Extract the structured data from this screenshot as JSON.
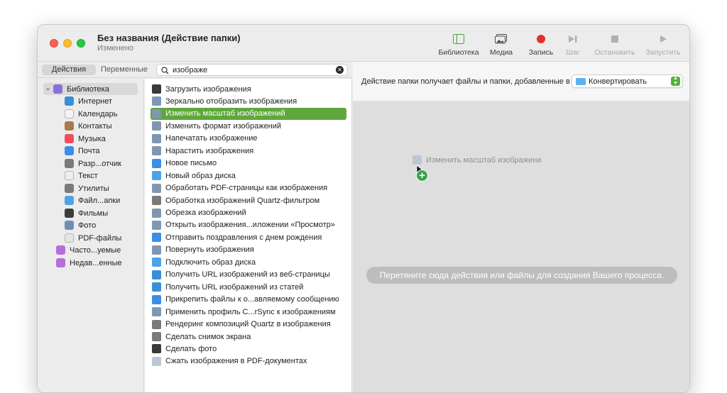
{
  "window": {
    "title": "Без названия (Действие папки)",
    "subtitle": "Изменено"
  },
  "toolbar": [
    {
      "label": "Библиотека",
      "icon": "library-icon",
      "enabled": true
    },
    {
      "label": "Медиа",
      "icon": "media-icon",
      "enabled": true
    },
    {
      "label": "Запись",
      "icon": "record-icon",
      "enabled": true
    },
    {
      "label": "Шаг",
      "icon": "step-icon",
      "enabled": false
    },
    {
      "label": "Остановить",
      "icon": "stop-icon",
      "enabled": false
    },
    {
      "label": "Запустить",
      "icon": "run-icon",
      "enabled": false
    }
  ],
  "tabs": {
    "actions": "Действия",
    "variables": "Переменные"
  },
  "search": {
    "value": "изображе"
  },
  "library": [
    {
      "label": "Библиотека",
      "icon": "library-icon",
      "selected": true,
      "color": "#8a6fd6"
    },
    {
      "label": "Интернет",
      "icon": "globe-icon",
      "color": "#3b8ed8"
    },
    {
      "label": "Календарь",
      "icon": "calendar-icon",
      "color": "#f4f4f4"
    },
    {
      "label": "Контакты",
      "icon": "contacts-icon",
      "color": "#a97a4c"
    },
    {
      "label": "Музыка",
      "icon": "music-icon",
      "color": "#f04d5b"
    },
    {
      "label": "Почта",
      "icon": "mail-icon",
      "color": "#3a8ee6"
    },
    {
      "label": "Разр...отчик",
      "icon": "developer-tools-icon",
      "color": "#7a7a7a"
    },
    {
      "label": "Текст",
      "icon": "text-icon",
      "color": "#eeeeee"
    },
    {
      "label": "Утилиты",
      "icon": "utilities-icon",
      "color": "#7a7a7a"
    },
    {
      "label": "Файл...апки",
      "icon": "finder-icon",
      "color": "#4da3e8"
    },
    {
      "label": "Фильмы",
      "icon": "movies-icon",
      "color": "#3c3c3c"
    },
    {
      "label": "Фото",
      "icon": "photo-icon",
      "color": "#6d8fb3"
    },
    {
      "label": "PDF-файлы",
      "icon": "pdf-icon",
      "color": "#e4e4e4"
    },
    {
      "label": "Часто...уемые",
      "icon": "smart-folder-icon",
      "color": "#b46fd8"
    },
    {
      "label": "Недав...енные",
      "icon": "smart-folder-icon",
      "color": "#b46fd8"
    }
  ],
  "actions": [
    {
      "label": "Загрузить изображения",
      "icon": "camera-icon",
      "color": "#3a3a3a"
    },
    {
      "label": "Зеркально отобразить изображения",
      "icon": "image-action-icon",
      "color": "#7f97b2"
    },
    {
      "label": "Изменить масштаб изображений",
      "icon": "image-action-icon",
      "color": "#7f97b2",
      "selected": true
    },
    {
      "label": "Изменить формат изображений",
      "icon": "image-action-icon",
      "color": "#7f97b2"
    },
    {
      "label": "Напечатать изображение",
      "icon": "image-action-icon",
      "color": "#7f97b2"
    },
    {
      "label": "Нарастить изображения",
      "icon": "image-action-icon",
      "color": "#7f97b2"
    },
    {
      "label": "Новое письмо",
      "icon": "mail-icon",
      "color": "#3a8ee6"
    },
    {
      "label": "Новый образ диска",
      "icon": "finder-icon",
      "color": "#4da3e8"
    },
    {
      "label": "Обработать PDF-страницы как изображения",
      "icon": "image-action-icon",
      "color": "#7f97b2"
    },
    {
      "label": "Обработка изображений Quartz-фильтром",
      "icon": "tools-icon",
      "color": "#7a7a7a"
    },
    {
      "label": "Обрезка изображений",
      "icon": "image-action-icon",
      "color": "#7f97b2"
    },
    {
      "label": "Открыть изображения...иложении «Просмотр»",
      "icon": "image-action-icon",
      "color": "#7f97b2"
    },
    {
      "label": "Отправить поздравления с днем рождения",
      "icon": "mail-icon",
      "color": "#3a8ee6"
    },
    {
      "label": "Повернуть изображения",
      "icon": "image-action-icon",
      "color": "#7f97b2"
    },
    {
      "label": "Подключить образ диска",
      "icon": "finder-icon",
      "color": "#4da3e8"
    },
    {
      "label": "Получить URL изображений из веб-страницы",
      "icon": "globe-icon",
      "color": "#3b8ed8"
    },
    {
      "label": "Получить URL изображений из статей",
      "icon": "globe-icon",
      "color": "#3b8ed8"
    },
    {
      "label": "Прикрепить файлы к о...авляемому сообщению",
      "icon": "mail-icon",
      "color": "#3a8ee6"
    },
    {
      "label": "Применить профиль C...rSync к изображениям",
      "icon": "image-action-icon",
      "color": "#7f97b2"
    },
    {
      "label": "Рендеринг композиций Quartz в изображения",
      "icon": "tools-icon",
      "color": "#7a7a7a"
    },
    {
      "label": "Сделать снимок экрана",
      "icon": "tools-icon",
      "color": "#7a7a7a"
    },
    {
      "label": "Сделать фото",
      "icon": "camera-icon",
      "color": "#3a3a3a"
    },
    {
      "label": "Сжать изображения в PDF-документах",
      "icon": "pdf-icon",
      "color": "#b9c7d6"
    }
  ],
  "workflow": {
    "receives_label": "Действие папки получает файлы и папки, добавленные в",
    "folder": "Конвертировать",
    "dragging_label": "Изменить масштаб изображени",
    "hint": "Перетяните сюда действия или файлы для создания Вашего процесса."
  },
  "colors": {
    "accent_selected": "#5fa73c",
    "record": "#e5312c"
  }
}
